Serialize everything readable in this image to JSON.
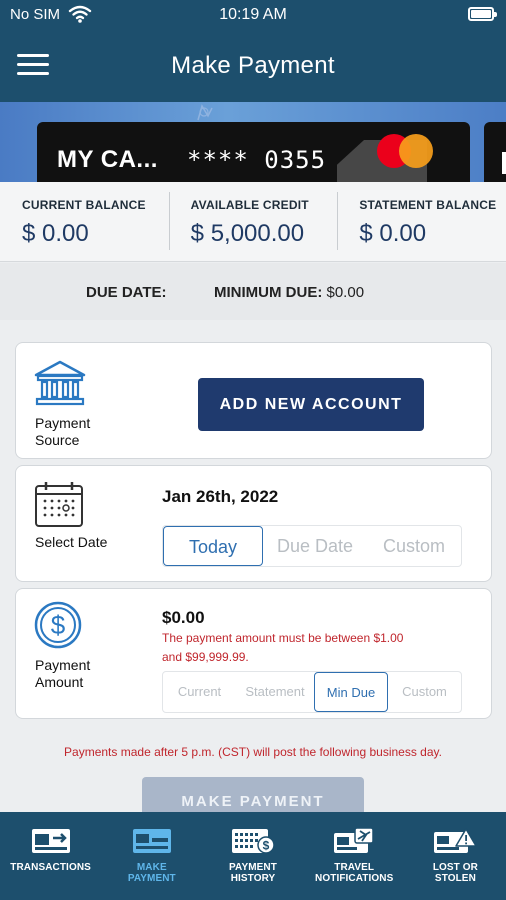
{
  "status_bar": {
    "carrier": "No SIM",
    "time": "10:19 AM"
  },
  "nav": {
    "title": "Make Payment"
  },
  "card": {
    "name": "MY CA...",
    "number": "**** 0355"
  },
  "balances": [
    {
      "label": "CURRENT BALANCE",
      "value": "$ 0.00"
    },
    {
      "label": "AVAILABLE CREDIT",
      "value": "$ 5,000.00"
    },
    {
      "label": "STATEMENT BALANCE",
      "value": "$ 0.00"
    }
  ],
  "due": {
    "due_date_label": "DUE DATE:",
    "min_due_label": "MINIMUM DUE:",
    "min_due_value": "$0.00"
  },
  "payment_source": {
    "label_line1": "Payment",
    "label_line2": "Source",
    "button_label": "ADD NEW ACCOUNT"
  },
  "select_date": {
    "label": "Select Date",
    "value": "Jan 26th, 2022",
    "options": [
      "Today",
      "Due Date",
      "Custom"
    ],
    "selected": "Today"
  },
  "payment_amount": {
    "label_line1": "Payment",
    "label_line2": "Amount",
    "value": "$0.00",
    "error_line1": "The payment amount must be between $1.00",
    "error_line2": "and $99,999.99.",
    "options": [
      "Current",
      "Statement",
      "Min Due",
      "Custom"
    ],
    "selected": "Min Due"
  },
  "notice": "Payments made after 5 p.m. (CST) will post the following business day.",
  "make_payment_button": "MAKE PAYMENT",
  "tabs": [
    {
      "line1": "TRANSACTIONS",
      "line2": "",
      "icon": "transactions-card-icon"
    },
    {
      "line1": "MAKE",
      "line2": "PAYMENT",
      "icon": "make-payment-card-icon",
      "active": true
    },
    {
      "line1": "PAYMENT",
      "line2": "HISTORY",
      "icon": "payment-history-icon"
    },
    {
      "line1": "TRAVEL",
      "line2": "NOTIFICATIONS",
      "icon": "travel-notifications-icon"
    },
    {
      "line1": "LOST OR",
      "line2": "STOLEN",
      "icon": "lost-stolen-warning-icon"
    }
  ],
  "colors": {
    "header": "#1d4f6d",
    "primary_button": "#1f3a6e",
    "disabled_button": "#a9b6c9",
    "error": "#c0262d",
    "selected_option": "#2f6fb0",
    "active_tab": "#5fb6ea"
  }
}
